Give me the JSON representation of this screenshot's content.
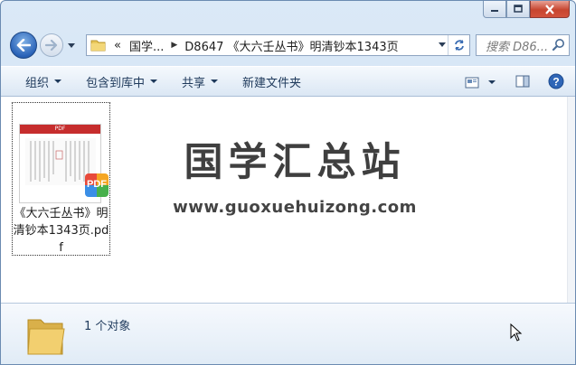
{
  "address_bar": {
    "overflow": "«",
    "crumbs": [
      "国学...",
      "D8647 《大六壬丛书》明清钞本1343页"
    ]
  },
  "search": {
    "placeholder": "搜索 D86..."
  },
  "toolbar": {
    "items": [
      "组织",
      "包含到库中",
      "共享",
      "新建文件夹"
    ]
  },
  "file": {
    "name": "《大六壬丛书》明清钞本1343页.pdf",
    "thumb_label": "PDF",
    "badge": "PDF"
  },
  "watermark": {
    "title": "国学汇总站",
    "url": "www.guoxuehuizong.com"
  },
  "status": {
    "count": "1 个对象"
  },
  "colors": {
    "accent": "#1e395b",
    "badge_red": "#c62d2d"
  }
}
